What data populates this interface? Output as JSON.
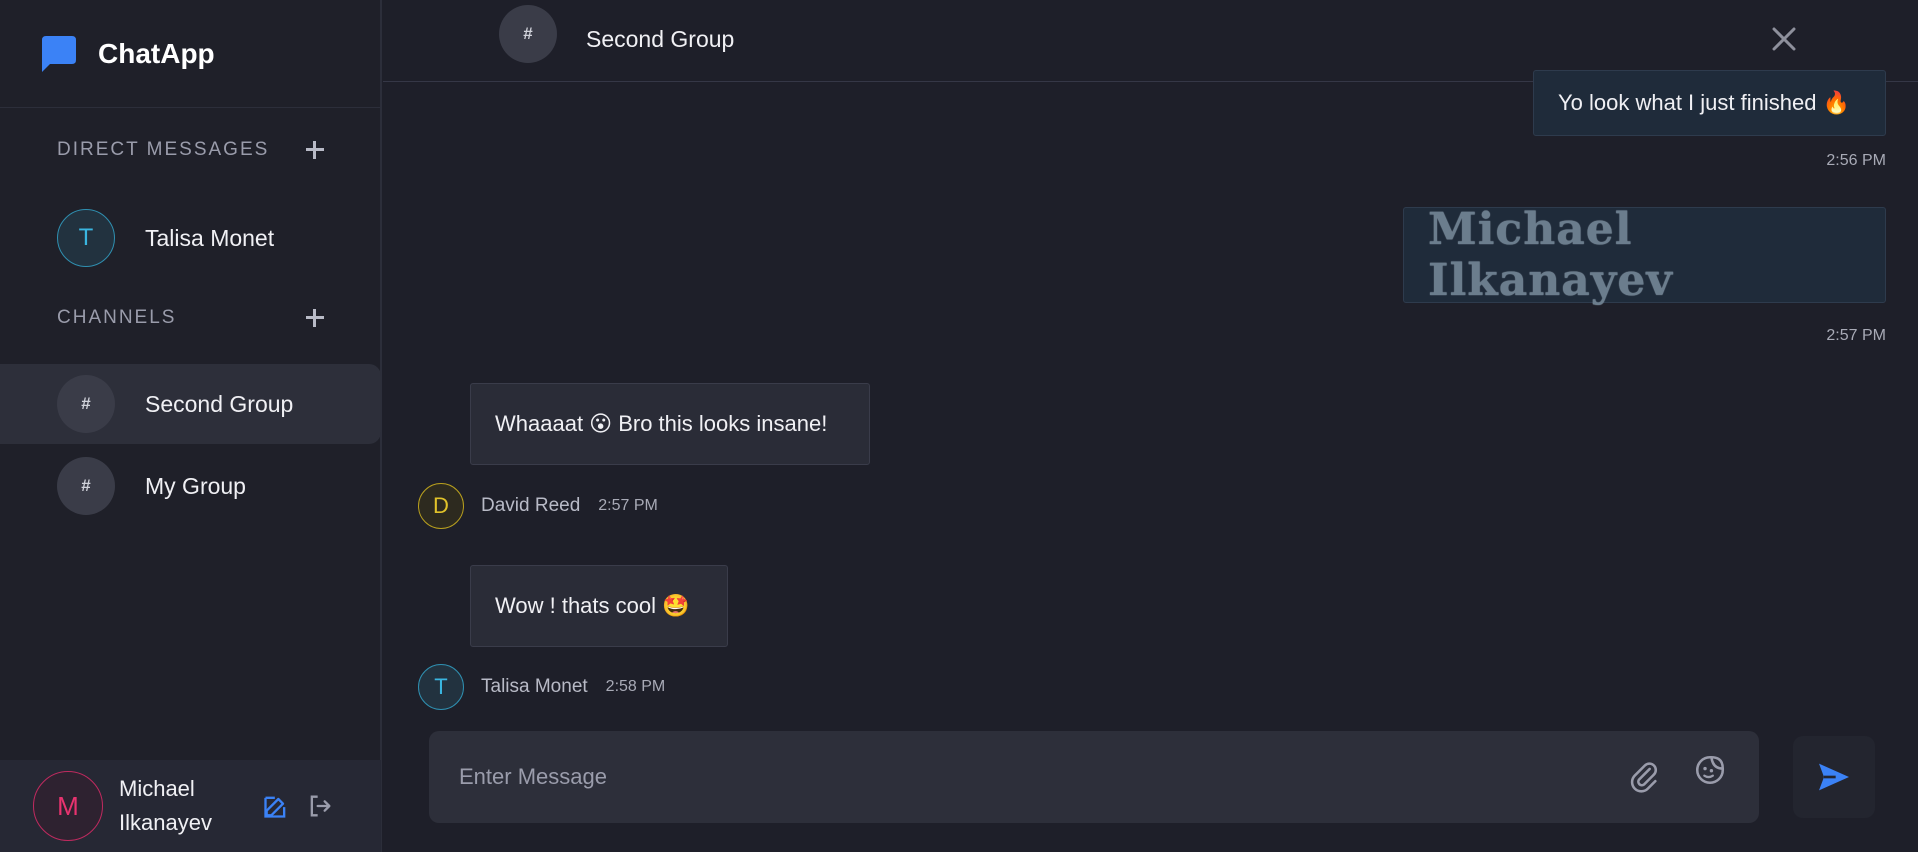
{
  "app": {
    "name": "ChatApp",
    "brand_color": "#3b82f6"
  },
  "sidebar": {
    "direct_messages": {
      "title": "DIRECT MESSAGES",
      "add_icon": "plus-icon",
      "items": [
        {
          "initial": "T",
          "label": "Talisa Monet"
        }
      ]
    },
    "channels": {
      "title": "CHANNELS",
      "add_icon": "plus-icon",
      "items": [
        {
          "icon": "#",
          "label": "Second Group",
          "active": true
        },
        {
          "icon": "#",
          "label": "My Group",
          "active": false
        }
      ]
    },
    "profile": {
      "initial": "M",
      "name_line1": "Michael",
      "name_line2": "Ilkanayev",
      "edit_icon": "edit-icon",
      "logout_icon": "logout-icon"
    }
  },
  "header": {
    "icon": "#",
    "title": "Second Group",
    "close_icon": "close-icon"
  },
  "messages": [
    {
      "sender": "me",
      "text": "Yo look what I just finished 🔥",
      "time": "2:56 PM"
    },
    {
      "sender": "me",
      "type": "signature",
      "text": "Michael Ilkanayev",
      "time": "2:57 PM"
    },
    {
      "sender": "David Reed",
      "initial": "D",
      "text": "Whaaaat 😮 Bro this looks insane!",
      "time": "2:57 PM"
    },
    {
      "sender": "Talisa Monet",
      "initial": "T",
      "text": "Wow ! thats cool 🤩",
      "time": "2:58 PM"
    }
  ],
  "composer": {
    "placeholder": "Enter Message",
    "attach_icon": "paperclip-icon",
    "sticker_icon": "sticker-icon",
    "send_icon": "send-icon"
  },
  "colors": {
    "background": "#1e1f29",
    "accent_blue": "#3b82f6",
    "talisa": "#3ab6e0",
    "david": "#e0c22a",
    "michael": "#e8336f"
  }
}
